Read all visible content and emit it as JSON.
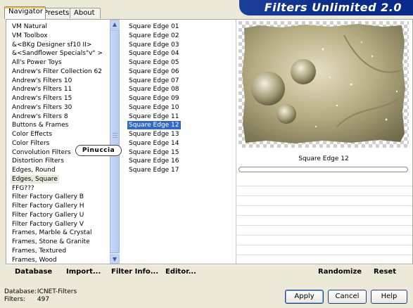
{
  "tabs": [
    "Navigator",
    "Presets",
    "About"
  ],
  "banner_title": "Filters Unlimited 2.0",
  "categories": [
    "VM Natural",
    "VM Toolbox",
    "&<BKg Designer sf10 II>",
    "&<Sandflower Specials\"v\" >",
    "All's Power Toys",
    "Andrew's Filter Collection 62",
    "Andrew's Filters 10",
    "Andrew's Filters 11",
    "Andrew's Filters 15",
    "Andrew's Filters 30",
    "Andrew's Filters 8",
    "Buttons & Frames",
    "Color Effects",
    "Color Filters",
    "Convolution Filters",
    "Distortion Filters",
    "Edges, Round",
    "Edges, Square",
    "FFG???",
    "Filter Factory Gallery B",
    "Filter Factory Gallery H",
    "Filter Factory Gallery U",
    "Filter Factory Gallery V",
    "Frames, Marble & Crystal",
    "Frames, Stone & Granite",
    "Frames, Textured",
    "Frames, Wood"
  ],
  "selected_category": "Edges, Square",
  "filters": [
    "Square Edge 01",
    "Square Edge 02",
    "Square Edge 03",
    "Square Edge 04",
    "Square Edge 05",
    "Square Edge 06",
    "Square Edge 07",
    "Square Edge 08",
    "Square Edge 09",
    "Square Edge 10",
    "Square Edge 11",
    "Square Edge 12",
    "Square Edge 13",
    "Square Edge 14",
    "Square Edge 15",
    "Square Edge 16",
    "Square Edge 17"
  ],
  "selected_filter": "Square Edge 12",
  "preview_label": "Square Edge 12",
  "watermark": "Pinuccia",
  "bottom_bar": {
    "database": "Database",
    "import": "Import...",
    "filter_info": "Filter Info...",
    "editor": "Editor...",
    "randomize": "Randomize",
    "reset": "Reset"
  },
  "status": {
    "database_label": "Database:",
    "database_value": "ICNET-Filters",
    "filters_label": "Filters:",
    "filters_value": "497"
  },
  "buttons": {
    "apply": "Apply",
    "cancel": "Cancel",
    "help": "Help"
  }
}
